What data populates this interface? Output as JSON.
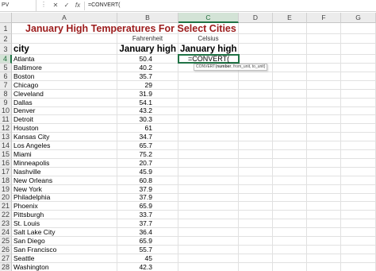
{
  "formula_bar": {
    "name_box": "PV",
    "dots": "⋮",
    "cancel_icon": "✕",
    "enter_icon": "✓",
    "function_icon": "fx",
    "content": "=CONVERT("
  },
  "columns": [
    "A",
    "B",
    "C",
    "D",
    "E",
    "F",
    "G"
  ],
  "row_numbers": [
    "1",
    "2",
    "3",
    "4",
    "5",
    "6",
    "7",
    "8",
    "9",
    "10",
    "11",
    "12",
    "13",
    "14",
    "15",
    "16",
    "17",
    "18",
    "19",
    "20",
    "21",
    "22",
    "23",
    "24",
    "25",
    "26",
    "27",
    "28"
  ],
  "sheet": {
    "title": "January High Temperatures For Select Cities",
    "unit_b": "Fahrenheit",
    "unit_c": "Celsius",
    "header_a": "city",
    "header_b": "January high",
    "header_c": "January high",
    "active_cell_text": "=CONVERT(",
    "tooltip_name": "CONVERT(",
    "tooltip_bold": "number",
    "tooltip_rest": ", from_unit, to_unit)",
    "rows": [
      {
        "city": "Atlanta",
        "temp": "50.4"
      },
      {
        "city": "Baltimore",
        "temp": "40.2"
      },
      {
        "city": "Boston",
        "temp": "35.7"
      },
      {
        "city": "Chicago",
        "temp": "29"
      },
      {
        "city": "Cleveland",
        "temp": "31.9"
      },
      {
        "city": "Dallas",
        "temp": "54.1"
      },
      {
        "city": "Denver",
        "temp": "43.2"
      },
      {
        "city": "Detroit",
        "temp": "30.3"
      },
      {
        "city": "Houston",
        "temp": "61"
      },
      {
        "city": "Kansas City",
        "temp": "34.7"
      },
      {
        "city": "Los Angeles",
        "temp": "65.7"
      },
      {
        "city": "Miami",
        "temp": "75.2"
      },
      {
        "city": "Minneapolis",
        "temp": "20.7"
      },
      {
        "city": "Nashville",
        "temp": "45.9"
      },
      {
        "city": "New Orleans",
        "temp": "60.8"
      },
      {
        "city": "New York",
        "temp": "37.9"
      },
      {
        "city": "Philadelphia",
        "temp": "37.9"
      },
      {
        "city": "Phoenix",
        "temp": "65.9"
      },
      {
        "city": "Pittsburgh",
        "temp": "33.7"
      },
      {
        "city": "St. Louis",
        "temp": "37.7"
      },
      {
        "city": "Salt Lake City",
        "temp": "36.4"
      },
      {
        "city": "San Diego",
        "temp": "65.9"
      },
      {
        "city": "San Francisco",
        "temp": "55.7"
      },
      {
        "city": "Seattle",
        "temp": "45"
      },
      {
        "city": "Washington",
        "temp": "42.3"
      }
    ]
  }
}
